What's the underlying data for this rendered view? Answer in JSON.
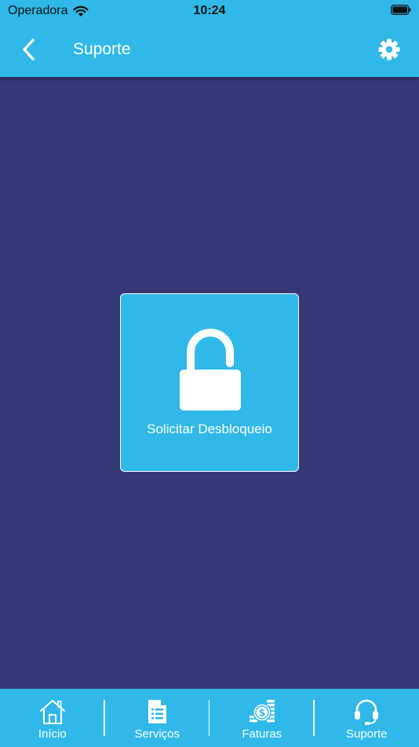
{
  "status_bar": {
    "carrier": "Operadora",
    "time": "10:24"
  },
  "header": {
    "title": "Suporte",
    "back_icon": "chevron-left-icon",
    "settings_icon": "gear-icon"
  },
  "main": {
    "action_card": {
      "label": "Solicitar Desbloqueio",
      "icon": "unlock-icon"
    }
  },
  "tabbar": {
    "items": [
      {
        "label": "Início",
        "icon": "home-icon"
      },
      {
        "label": "Serviços",
        "icon": "document-list-icon"
      },
      {
        "label": "Faturas",
        "icon": "money-icon"
      },
      {
        "label": "Suporte",
        "icon": "headset-icon"
      }
    ]
  },
  "colors": {
    "primary": "#30b8e8",
    "background": "#363875",
    "foreground": "#ffffff"
  }
}
